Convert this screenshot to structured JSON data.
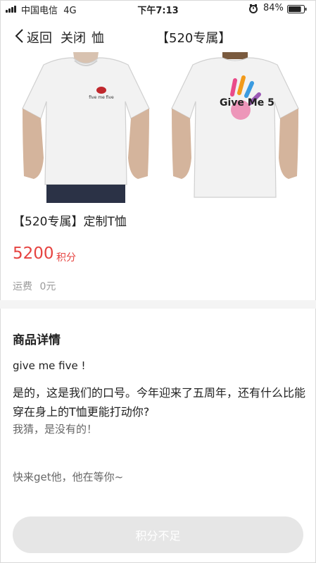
{
  "status_bar": {
    "carrier": "中国电信",
    "network": "4G",
    "time": "下午7:13",
    "battery": "84%",
    "battery_level": 0.84
  },
  "nav": {
    "back_label": "返回",
    "close_label": "关闭",
    "title_fragment": "恤",
    "title_main": "【520专属】"
  },
  "product": {
    "front_logo_text": "five me five",
    "back_print_text": "Give Me 5",
    "title": "【520专属】定制T恤",
    "price": "5200",
    "price_unit": "积分",
    "shipping_label": "运费",
    "shipping_value": "0元"
  },
  "details": {
    "heading": "商品详情",
    "line1": "give me five !",
    "line2": "是的，这是我们的口号。今年迎来了五周年，还有什么比能穿在身上的T恤更能打动你?",
    "line3": "我猜，是没有的！",
    "line4": "快来get他，他在等你~"
  },
  "action": {
    "button_label": "积分不足"
  },
  "colors": {
    "accent": "#e64340",
    "muted": "#999999",
    "button_disabled_bg": "#e6e6e6"
  }
}
